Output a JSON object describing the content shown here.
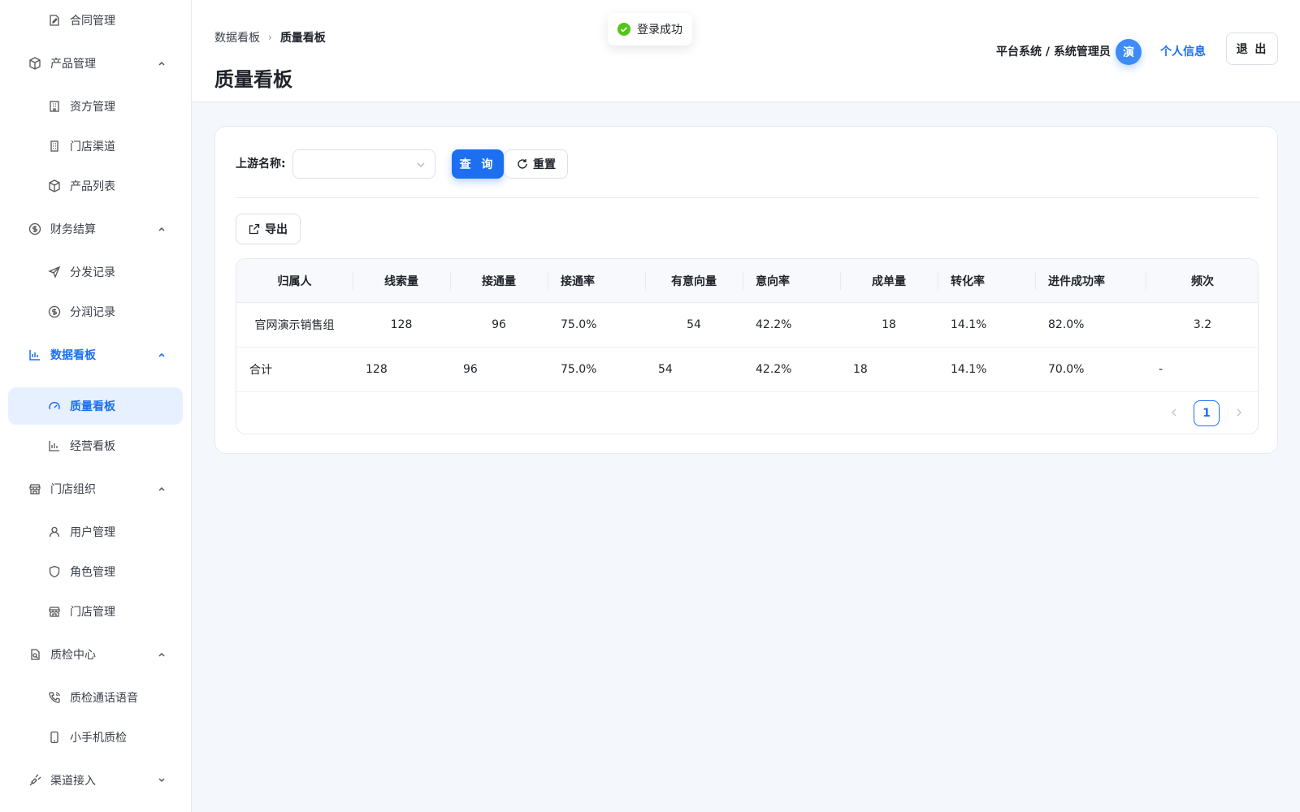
{
  "toast": {
    "message": "登录成功"
  },
  "sidebar": {
    "top_item": "合同管理",
    "groups": [
      {
        "label": "产品管理",
        "items": [
          "资方管理",
          "门店渠道",
          "产品列表"
        ]
      },
      {
        "label": "财务结算",
        "items": [
          "分发记录",
          "分润记录"
        ]
      },
      {
        "label": "数据看板",
        "items": [
          "质量看板",
          "经营看板"
        ]
      },
      {
        "label": "门店组织",
        "items": [
          "用户管理",
          "角色管理",
          "门店管理"
        ]
      },
      {
        "label": "质检中心",
        "items": [
          "质检通话语音",
          "小手机质检"
        ]
      },
      {
        "label": "渠道接入",
        "items": []
      }
    ],
    "active_group": "数据看板",
    "active_item": "质量看板",
    "accent_color": "#1d6ff2"
  },
  "header": {
    "breadcrumb": [
      "数据看板",
      "质量看板"
    ],
    "title": "质量看板",
    "user_role": "平台系统 / 系统管理员",
    "avatar_text": "演",
    "profile_link": "个人信息",
    "logout_label": "退 出"
  },
  "filters": {
    "upstream_label": "上游名称:",
    "upstream_value": "",
    "query_label": "查 询",
    "reset_label": "重置"
  },
  "toolbar": {
    "export_label": "导出"
  },
  "table": {
    "columns": [
      "归属人",
      "线索量",
      "接通量",
      "接通率",
      "有意向量",
      "意向率",
      "成单量",
      "转化率",
      "进件成功率",
      "频次"
    ],
    "rows": [
      [
        "官网演示销售组",
        "128",
        "96",
        "75.0%",
        "54",
        "42.2%",
        "18",
        "14.1%",
        "82.0%",
        "3.2"
      ]
    ],
    "summary": [
      "合计",
      "128",
      "96",
      "75.0%",
      "54",
      "42.2%",
      "18",
      "14.1%",
      "70.0%",
      "-"
    ]
  },
  "pagination": {
    "current_page": "1"
  }
}
